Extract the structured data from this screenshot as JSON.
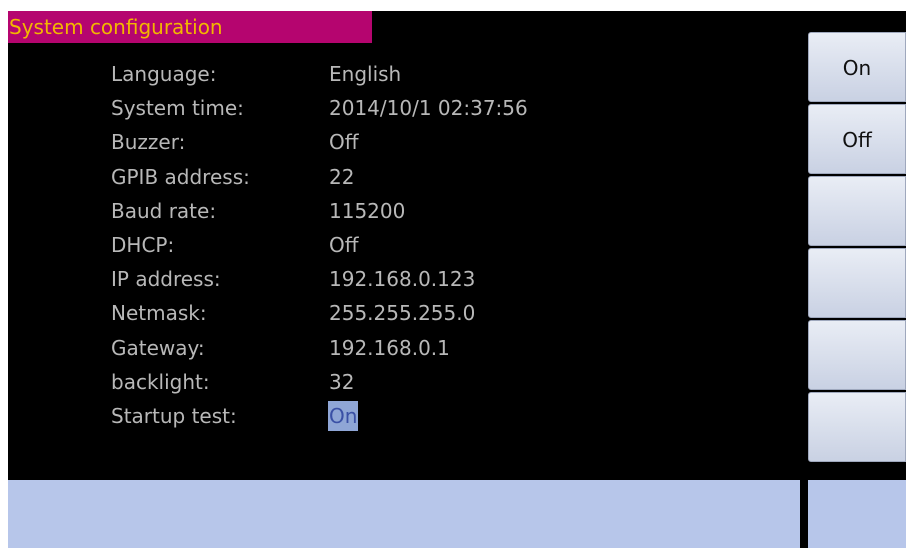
{
  "title": "System configuration",
  "settings": [
    {
      "label": "Language:",
      "value": "English"
    },
    {
      "label": "System time:",
      "value": "2014/10/1 02:37:56"
    },
    {
      "label": "Buzzer:",
      "value": "Off"
    },
    {
      "label": "GPIB address:",
      "value": "22"
    },
    {
      "label": "Baud rate:",
      "value": "115200"
    },
    {
      "label": "DHCP:",
      "value": "Off"
    },
    {
      "label": "IP address:",
      "value": "192.168.0.123"
    },
    {
      "label": "Netmask:",
      "value": "255.255.255.0"
    },
    {
      "label": "Gateway:",
      "value": "192.168.0.1"
    },
    {
      "label": "backlight:",
      "value": "32"
    },
    {
      "label": "Startup test:",
      "value": "On"
    }
  ],
  "softkeys": [
    "On",
    "Off",
    "",
    "",
    "",
    ""
  ],
  "colors": {
    "screen_bg": "#000000",
    "title_bg": "#b5056f",
    "title_text": "#f2b700",
    "text": "#b8b8b8",
    "selection_bg": "#8fa6d6",
    "softkey_bg": "#dde3f0",
    "bottom_bar": "#b7c6ea"
  }
}
